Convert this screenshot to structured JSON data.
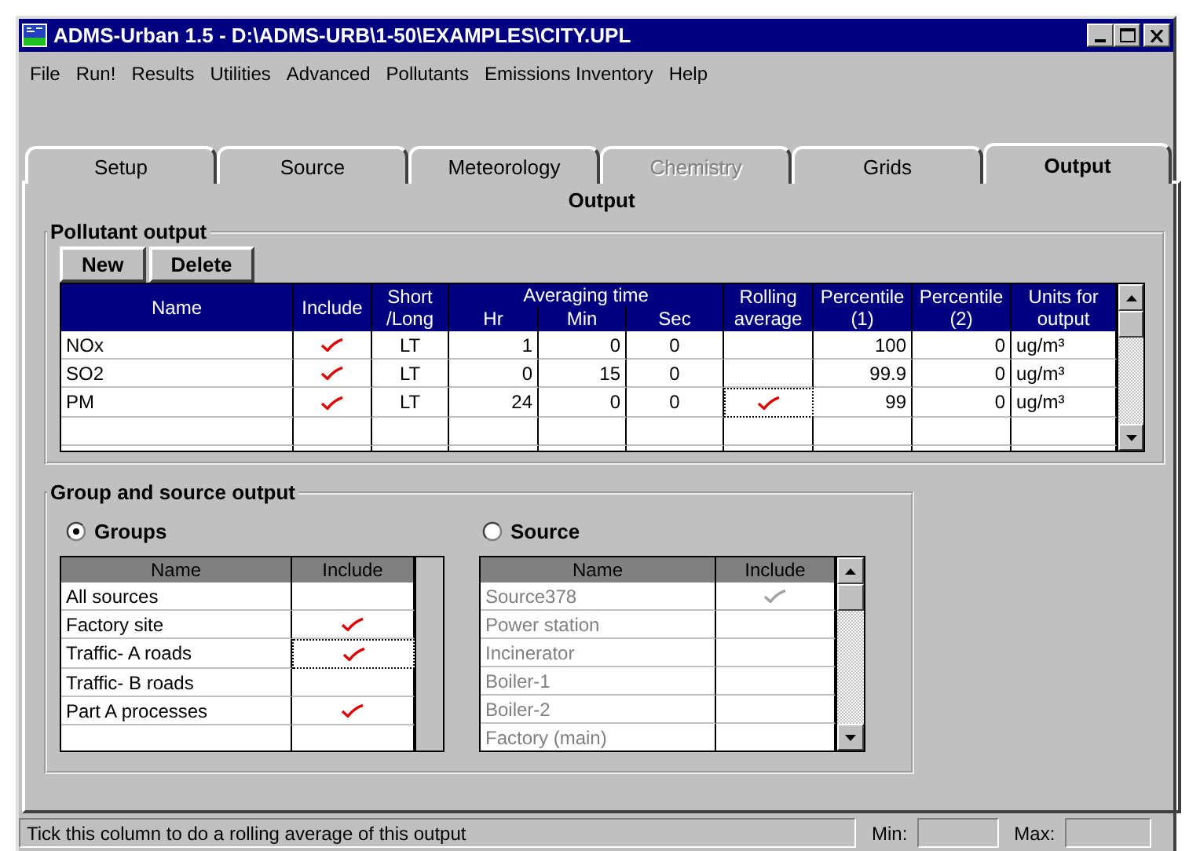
{
  "window": {
    "title": "ADMS-Urban 1.5 - D:\\ADMS-URB\\1-50\\EXAMPLES\\CITY.UPL"
  },
  "menu": [
    {
      "label": "File"
    },
    {
      "label": "Run!"
    },
    {
      "label": "Results"
    },
    {
      "label": "Utilities"
    },
    {
      "label": "Advanced"
    },
    {
      "label": "Pollutants"
    },
    {
      "label": "Emissions Inventory"
    },
    {
      "label": "Help"
    }
  ],
  "tabs": [
    {
      "label": "Setup",
      "selected": false,
      "disabled": false
    },
    {
      "label": "Source",
      "selected": false,
      "disabled": false
    },
    {
      "label": "Meteorology",
      "selected": false,
      "disabled": false
    },
    {
      "label": "Chemistry",
      "selected": false,
      "disabled": true
    },
    {
      "label": "Grids",
      "selected": false,
      "disabled": false
    },
    {
      "label": "Output",
      "selected": true,
      "disabled": false
    }
  ],
  "output": {
    "title": "Output",
    "pollutant_output": {
      "title": "Pollutant output",
      "buttons": [
        "New",
        "Delete"
      ],
      "columns": [
        {
          "label": "Name"
        },
        {
          "label": "Include"
        },
        {
          "label": "Short /Long"
        },
        {
          "label": "Averaging time",
          "sub": [
            "Hr",
            "Min",
            "Sec"
          ]
        },
        {
          "label": "Rolling average"
        },
        {
          "label": "Percentile (1)"
        },
        {
          "label": "Percentile (2)"
        },
        {
          "label": "Units for output"
        }
      ],
      "rows": [
        {
          "name": "NOx",
          "include": true,
          "short_long": "LT",
          "hr": "1",
          "min": "0",
          "sec": "0",
          "rolling_average": false,
          "rolling_focused": false,
          "percentile_1": "100",
          "percentile_2": "0",
          "units": "ug/m³"
        },
        {
          "name": "SO2",
          "include": true,
          "short_long": "LT",
          "hr": "0",
          "min": "15",
          "sec": "0",
          "rolling_average": false,
          "rolling_focused": false,
          "percentile_1": "99.9",
          "percentile_2": "0",
          "units": "ug/m³"
        },
        {
          "name": "PM",
          "include": true,
          "short_long": "LT",
          "hr": "24",
          "min": "0",
          "sec": "0",
          "rolling_average": true,
          "rolling_focused": true,
          "percentile_1": "99",
          "percentile_2": "0",
          "units": "ug/m³"
        }
      ]
    },
    "group_output": {
      "title": "Group and source output",
      "options": [
        {
          "label": "Groups",
          "selected": true
        },
        {
          "label": "Source",
          "selected": false
        }
      ],
      "groups": {
        "disabled": false,
        "columns": [
          "Name",
          "Include"
        ],
        "rows": [
          {
            "name": "All sources",
            "include": false,
            "focused": false
          },
          {
            "name": "Factory site",
            "include": true,
            "focused": false
          },
          {
            "name": "Traffic- A roads",
            "include": true,
            "focused": true
          },
          {
            "name": "Traffic- B roads",
            "include": false,
            "focused": false
          },
          {
            "name": "Part A processes",
            "include": true,
            "focused": false
          }
        ]
      },
      "sources": {
        "disabled": true,
        "columns": [
          "Name",
          "Include"
        ],
        "rows": [
          {
            "name": "Source378",
            "include": true,
            "focused": false
          },
          {
            "name": "Power station",
            "include": false,
            "focused": false
          },
          {
            "name": "Incinerator",
            "include": false,
            "focused": false
          },
          {
            "name": "Boiler-1",
            "include": false,
            "focused": false
          },
          {
            "name": "Boiler-2",
            "include": false,
            "focused": false
          },
          {
            "name": "Factory (main)",
            "include": false,
            "focused": false
          }
        ]
      }
    }
  },
  "status_bar": {
    "message": "Tick this column to do a rolling average of this output",
    "min_label": "Min:",
    "max_label": "Max:"
  }
}
